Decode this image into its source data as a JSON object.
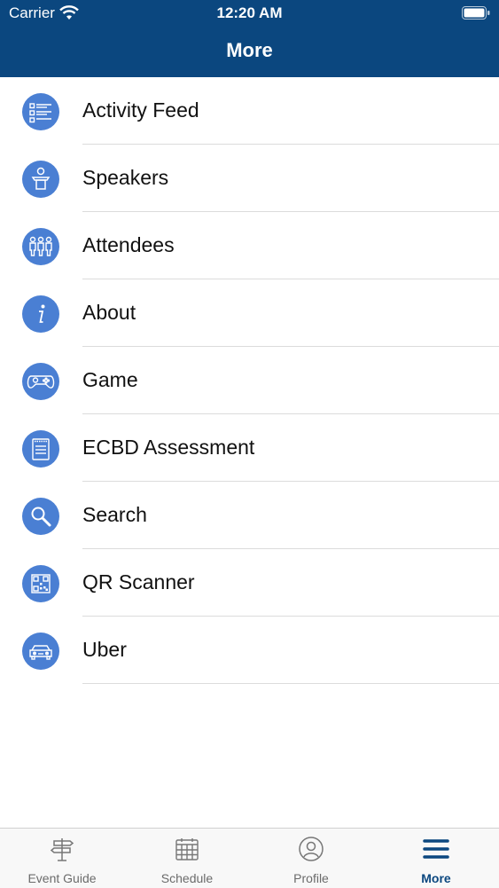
{
  "status_bar": {
    "carrier": "Carrier",
    "time": "12:20 AM"
  },
  "header": {
    "title": "More"
  },
  "menu": [
    {
      "label": "Activity Feed",
      "icon": "list-icon"
    },
    {
      "label": "Speakers",
      "icon": "podium-icon"
    },
    {
      "label": "Attendees",
      "icon": "people-icon"
    },
    {
      "label": "About",
      "icon": "info-icon"
    },
    {
      "label": "Game",
      "icon": "gamepad-icon"
    },
    {
      "label": "ECBD Assessment",
      "icon": "notepad-icon"
    },
    {
      "label": "Search",
      "icon": "search-icon"
    },
    {
      "label": "QR Scanner",
      "icon": "qr-code-icon"
    },
    {
      "label": "Uber",
      "icon": "car-icon"
    }
  ],
  "tabbar": {
    "tabs": [
      {
        "label": "Event Guide",
        "icon": "signpost-icon",
        "active": false
      },
      {
        "label": "Schedule",
        "icon": "calendar-icon",
        "active": false
      },
      {
        "label": "Profile",
        "icon": "profile-icon",
        "active": false
      },
      {
        "label": "More",
        "icon": "menu-icon",
        "active": true
      }
    ]
  },
  "colors": {
    "header": "#0b477f",
    "icon_bg": "#4a7fd3",
    "active_tab": "#0b477f"
  }
}
